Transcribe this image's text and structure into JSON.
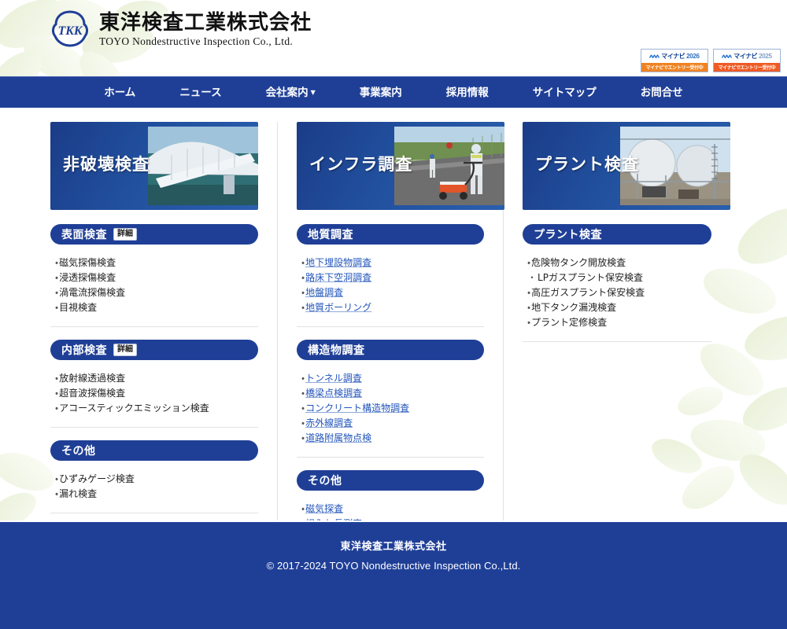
{
  "site": {
    "logo_icon": "tkk-logo-icon",
    "name_jp": "東洋検査工業株式会社",
    "name_en": "TOYO Nondestructive Inspection Co., Ltd."
  },
  "banners": [
    {
      "icon": "mynavi-zigzag-icon",
      "brand": "マイナビ",
      "year": "2026",
      "cta": "マイナビでエントリー受付中"
    },
    {
      "icon": "mynavi-zigzag-icon",
      "brand": "マイナビ",
      "year": "2025",
      "cta": "マイナビでエントリー受付中"
    }
  ],
  "nav": {
    "items": [
      {
        "label": "ホーム",
        "has_dropdown": false
      },
      {
        "label": "ニュース",
        "has_dropdown": false
      },
      {
        "label": "会社案内",
        "has_dropdown": true,
        "caret": "▼"
      },
      {
        "label": "事業案内",
        "has_dropdown": false
      },
      {
        "label": "採用情報",
        "has_dropdown": false
      },
      {
        "label": "サイトマップ",
        "has_dropdown": false
      },
      {
        "label": "お問合せ",
        "has_dropdown": false
      }
    ]
  },
  "columns": [
    {
      "hero": {
        "title": "非破壊検査",
        "photo": "bridge-photo"
      },
      "sections": [
        {
          "title": "表面検査",
          "detail_label": "詳細",
          "links": false,
          "items": [
            "磁気探傷検査",
            "浸透探傷検査",
            "渦電流探傷検査",
            "目視検査"
          ]
        },
        {
          "title": "内部検査",
          "detail_label": "詳細",
          "links": false,
          "items": [
            "放射線透過検査",
            "超音波探傷検査",
            "アコースティックエミッション検査"
          ]
        },
        {
          "title": "その他",
          "detail_label": "",
          "links": false,
          "items": [
            "ひずみゲージ検査",
            "漏れ検査"
          ]
        }
      ]
    },
    {
      "hero": {
        "title": "インフラ調査",
        "photo": "road-survey-photo"
      },
      "sections": [
        {
          "title": "地質調査",
          "detail_label": "",
          "links": true,
          "items": [
            "地下埋設物調査",
            "路床下空洞調査",
            "地盤調査",
            "地質ボーリング"
          ]
        },
        {
          "title": "構造物調査",
          "detail_label": "",
          "links": true,
          "items": [
            "トンネル調査",
            "橋梁点検調査",
            "コンクリート構造物調査",
            "赤外線調査",
            "道路附属物点検"
          ]
        },
        {
          "title": "その他",
          "detail_label": "",
          "links": true,
          "items": [
            "磁気探査",
            "根入れ長測定"
          ]
        }
      ]
    },
    {
      "hero": {
        "title": "プラント検査",
        "photo": "gas-tank-photo"
      },
      "sections": [
        {
          "title": "プラント検査",
          "detail_label": "",
          "links": false,
          "items": [
            "危険物タンク開放検査",
            "LPガスプラント保安検査",
            "高圧ガスプラント保安検査",
            "地下タンク漏洩検査",
            "プラント定修検査"
          ]
        }
      ]
    }
  ],
  "footer": {
    "company": "東洋検査工業株式会社",
    "copyright": "© 2017-2024 TOYO Nondestructive Inspection Co.,Ltd."
  },
  "colors": {
    "brand_blue": "#1f3f97",
    "link_blue": "#2255bb",
    "accent_orange": "#f08221",
    "leaf_green": "#dbe8c4"
  }
}
